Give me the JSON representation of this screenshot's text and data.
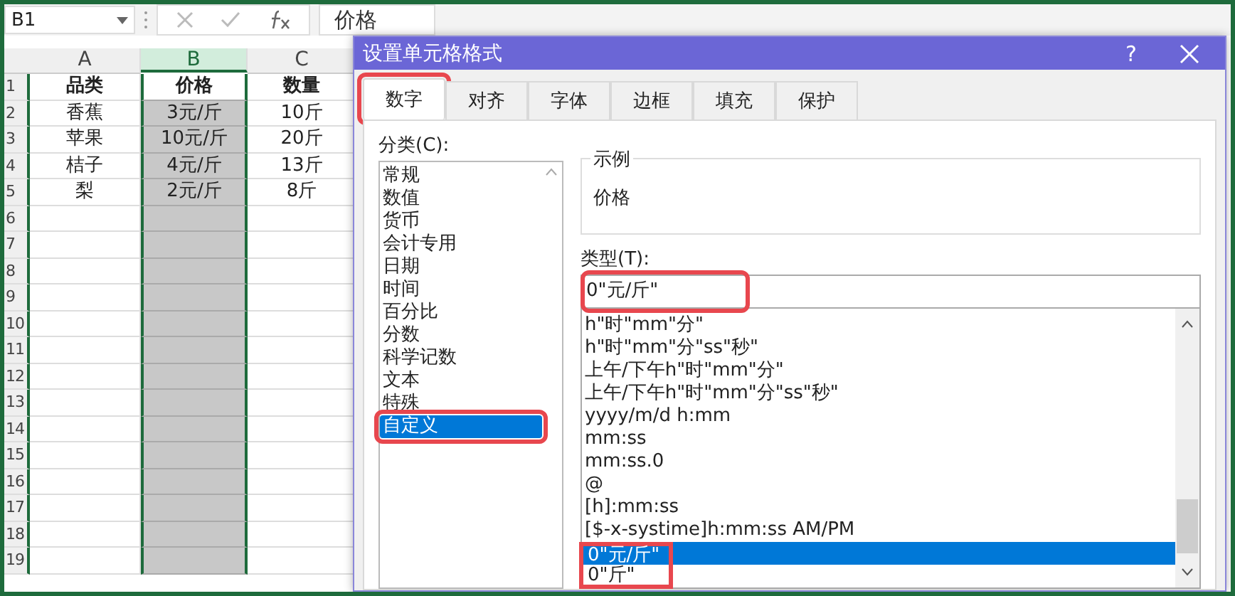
{
  "name_box": "B1",
  "formula_value": "价格",
  "columns": [
    {
      "label": "A",
      "selected": false
    },
    {
      "label": "B",
      "selected": true
    },
    {
      "label": "C",
      "selected": false
    }
  ],
  "rows": [
    {
      "number": "1",
      "kind": "header",
      "cells": [
        "品类",
        "价格",
        "数量"
      ]
    },
    {
      "number": "2",
      "kind": "data",
      "cells": [
        "香蕉",
        "3元/斤",
        "10斤"
      ]
    },
    {
      "number": "3",
      "kind": "data",
      "cells": [
        "苹果",
        "10元/斤",
        "20斤"
      ]
    },
    {
      "number": "4",
      "kind": "data",
      "cells": [
        "桔子",
        "4元/斤",
        "13斤"
      ]
    },
    {
      "number": "5",
      "kind": "data",
      "cells": [
        "梨",
        "2元/斤",
        "8斤"
      ]
    },
    {
      "number": "6"
    },
    {
      "number": "7"
    },
    {
      "number": "8"
    },
    {
      "number": "9"
    },
    {
      "number": "10"
    },
    {
      "number": "11"
    },
    {
      "number": "12"
    },
    {
      "number": "13"
    },
    {
      "number": "14"
    },
    {
      "number": "15"
    },
    {
      "number": "16"
    },
    {
      "number": "17"
    },
    {
      "number": "18"
    },
    {
      "number": "19"
    }
  ],
  "dialog": {
    "title": "设置单元格格式",
    "help": "?",
    "tabs": [
      {
        "label": "数字",
        "selected": true,
        "highlighted": true
      },
      {
        "label": "对齐",
        "selected": false,
        "highlighted": false
      },
      {
        "label": "字体",
        "selected": false,
        "highlighted": false
      },
      {
        "label": "边框",
        "selected": false,
        "highlighted": false
      },
      {
        "label": "填充",
        "selected": false,
        "highlighted": false
      },
      {
        "label": "保护",
        "selected": false,
        "highlighted": false
      }
    ],
    "category_label": "分类(C):",
    "categories": [
      {
        "label": "常规",
        "selected": false,
        "highlighted": false
      },
      {
        "label": "数值",
        "selected": false,
        "highlighted": false
      },
      {
        "label": "货币",
        "selected": false,
        "highlighted": false
      },
      {
        "label": "会计专用",
        "selected": false,
        "highlighted": false
      },
      {
        "label": "日期",
        "selected": false,
        "highlighted": false
      },
      {
        "label": "时间",
        "selected": false,
        "highlighted": false
      },
      {
        "label": "百分比",
        "selected": false,
        "highlighted": false
      },
      {
        "label": "分数",
        "selected": false,
        "highlighted": false
      },
      {
        "label": "科学记数",
        "selected": false,
        "highlighted": false
      },
      {
        "label": "文本",
        "selected": false,
        "highlighted": false
      },
      {
        "label": "特殊",
        "selected": false,
        "highlighted": false
      },
      {
        "label": "自定义",
        "selected": true,
        "highlighted": true
      }
    ],
    "sample": {
      "label": "示例",
      "value": "价格"
    },
    "type_label": "类型(T):",
    "type_field": {
      "value": "0\"元/斤\"",
      "highlighted": true
    },
    "formats": [
      {
        "label": "h\"时\"mm\"分\"",
        "selected": false,
        "highlighted": false
      },
      {
        "label": "h\"时\"mm\"分\"ss\"秒\"",
        "selected": false,
        "highlighted": false
      },
      {
        "label": "上午/下午h\"时\"mm\"分\"",
        "selected": false,
        "highlighted": false
      },
      {
        "label": "上午/下午h\"时\"mm\"分\"ss\"秒\"",
        "selected": false,
        "highlighted": false
      },
      {
        "label": "yyyy/m/d h:mm",
        "selected": false,
        "highlighted": false
      },
      {
        "label": "mm:ss",
        "selected": false,
        "highlighted": false
      },
      {
        "label": "mm:ss.0",
        "selected": false,
        "highlighted": false
      },
      {
        "label": "@",
        "selected": false,
        "highlighted": false
      },
      {
        "label": "[h]:mm:ss",
        "selected": false,
        "highlighted": false
      },
      {
        "label": "[$-x-systime]h:mm:ss AM/PM",
        "selected": false,
        "highlighted": false
      },
      {
        "label": "0\"元/斤\"",
        "selected": true,
        "highlighted": true
      },
      {
        "label": "0\"斤\"",
        "selected": false,
        "highlighted": true
      }
    ]
  }
}
